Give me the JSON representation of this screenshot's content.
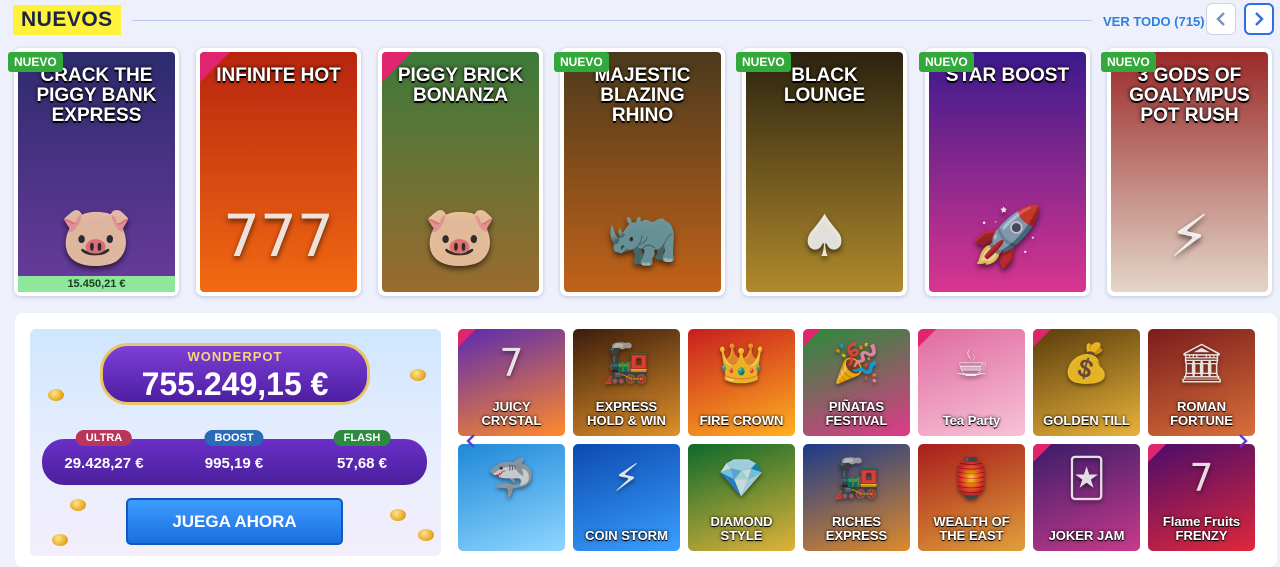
{
  "section": {
    "title": "NUEVOS",
    "view_all_label": "VER TODO (715)"
  },
  "nav": {
    "prev_icon": "chevron-left-icon",
    "next_icon": "chevron-right-icon"
  },
  "new_games": [
    {
      "title": "CRACK THE PIGGY BANK EXPRESS",
      "badge": "NUEVO",
      "exclusive": false,
      "jackpot": "15.450,21 €",
      "colors": [
        "#2d2b6e",
        "#6a3b9c"
      ],
      "glyph": "🐷"
    },
    {
      "title": "INFINITE HOT",
      "badge": "",
      "exclusive": true,
      "jackpot": "",
      "colors": [
        "#b8250f",
        "#f26a12"
      ],
      "glyph": "777"
    },
    {
      "title": "PIGGY BRICK BONANZA",
      "badge": "",
      "exclusive": true,
      "jackpot": "",
      "colors": [
        "#3c7a3a",
        "#9a6b2f"
      ],
      "glyph": "🐷"
    },
    {
      "title": "MAJESTIC BLAZING RHINO",
      "badge": "NUEVO",
      "exclusive": false,
      "jackpot": "",
      "colors": [
        "#4a3a1c",
        "#c2621a"
      ],
      "glyph": "🦏"
    },
    {
      "title": "BLACK LOUNGE",
      "badge": "NUEVO",
      "exclusive": false,
      "jackpot": "",
      "colors": [
        "#2b2210",
        "#b08a2c"
      ],
      "glyph": "♠"
    },
    {
      "title": "STAR BOOST",
      "badge": "NUEVO",
      "exclusive": false,
      "jackpot": "",
      "colors": [
        "#3a1a8c",
        "#d8358f"
      ],
      "glyph": "🚀"
    },
    {
      "title": "3 GODS OF GOALYMPUS POT RUSH",
      "badge": "NUEVO",
      "exclusive": false,
      "jackpot": "",
      "colors": [
        "#9a2a2a",
        "#e4d6c8"
      ],
      "glyph": "⚡"
    }
  ],
  "wonderpot": {
    "label": "WONDERPOT",
    "amount": "755.249,15 €",
    "tiers": [
      {
        "label": "ULTRA",
        "value": "29.428,27 €",
        "color": "#b8355c"
      },
      {
        "label": "BOOST",
        "value": "995,19 €",
        "color": "#2a6ab8"
      },
      {
        "label": "FLASH",
        "value": "57,68 €",
        "color": "#2e8a3e"
      }
    ],
    "play_label": "JUEGA AHORA"
  },
  "grid_games": [
    {
      "title": "JUICY CRYSTAL",
      "exclusive": true,
      "colors": [
        "#5a2ab0",
        "#ff8a2a"
      ],
      "glyph": "7"
    },
    {
      "title": "EXPRESS HOLD & WIN",
      "exclusive": false,
      "colors": [
        "#3a1c0c",
        "#e0912a"
      ],
      "glyph": "🚂"
    },
    {
      "title": "FIRE CROWN",
      "exclusive": false,
      "colors": [
        "#c81e1e",
        "#ffb020"
      ],
      "glyph": "👑"
    },
    {
      "title": "PIÑATAS FESTIVAL",
      "exclusive": true,
      "colors": [
        "#2a8a3a",
        "#e03a8a"
      ],
      "glyph": "🎉"
    },
    {
      "title": "Tea Party",
      "exclusive": true,
      "colors": [
        "#e06aa0",
        "#f7c3d6"
      ],
      "glyph": "☕"
    },
    {
      "title": "GOLDEN TILL",
      "exclusive": true,
      "colors": [
        "#5a3c0c",
        "#e8b23a"
      ],
      "glyph": "💰"
    },
    {
      "title": "ROMAN FORTUNE",
      "exclusive": false,
      "colors": [
        "#7a1c1c",
        "#d8703a"
      ],
      "glyph": "🏛"
    },
    {
      "title": "",
      "exclusive": false,
      "colors": [
        "#1e88d8",
        "#8fd6ff"
      ],
      "glyph": "🦈"
    },
    {
      "title": "COIN STORM",
      "exclusive": false,
      "colors": [
        "#0c4ab0",
        "#3aa0ff"
      ],
      "glyph": "⚡"
    },
    {
      "title": "DIAMOND STYLE",
      "exclusive": false,
      "colors": [
        "#0c6a2a",
        "#e0b23a"
      ],
      "glyph": "💎"
    },
    {
      "title": "RICHES EXPRESS",
      "exclusive": false,
      "colors": [
        "#1a3a8a",
        "#e08a2a"
      ],
      "glyph": "🚂"
    },
    {
      "title": "WEALTH OF THE EAST",
      "exclusive": false,
      "colors": [
        "#a81c1c",
        "#e0a03a"
      ],
      "glyph": "🏮"
    },
    {
      "title": "JOKER JAM",
      "exclusive": true,
      "colors": [
        "#3a1c6a",
        "#c83a8a"
      ],
      "glyph": "🃏"
    },
    {
      "title": "Flame Fruits FRENZY",
      "exclusive": true,
      "colors": [
        "#4a0c6a",
        "#e0283a"
      ],
      "glyph": "7"
    }
  ],
  "grid_nav": {
    "prev_icon": "chevron-left-icon",
    "next_icon": "chevron-right-icon"
  }
}
